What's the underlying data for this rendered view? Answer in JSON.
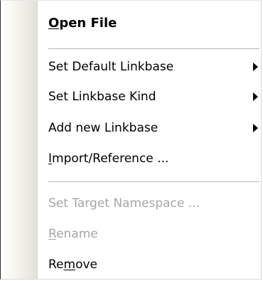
{
  "menu": {
    "open_file": {
      "mnemonic": "O",
      "rest": "pen File"
    },
    "set_default_linkbase": "Set Default Linkbase",
    "set_linkbase_kind": "Set Linkbase Kind",
    "add_new_linkbase": "Add new Linkbase",
    "import_reference": {
      "mnemonic": "I",
      "rest": "mport/Reference ..."
    },
    "set_target_namespace": "Set Target Namespace ...",
    "rename": {
      "mnemonic": "R",
      "rest": "ename"
    },
    "remove": {
      "before": "Re",
      "mnemonic": "m",
      "after": "ove"
    },
    "submenu_arrow_icon": "submenu-arrow-right"
  }
}
